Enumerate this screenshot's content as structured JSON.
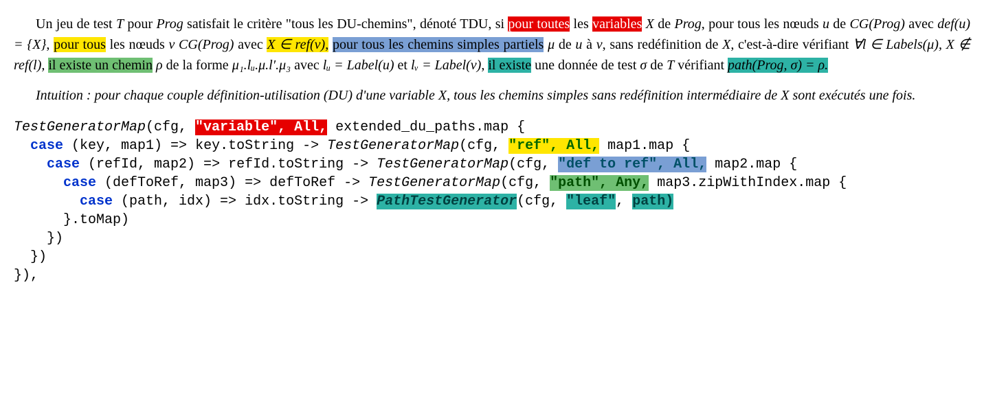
{
  "p1": {
    "t1": "Un jeu de test ",
    "T": "T",
    "t2": " pour ",
    "Prog": "Prog",
    "t3": " satisfait le critère \"tous les DU-chemins\", dénoté TDU, si ",
    "hl_pour_toutes": "pour toutes",
    "t4": " les ",
    "hl_variables": "variables",
    "t5": " ",
    "X": "X",
    "t6": " de ",
    "Prog2": "Prog",
    "t7": ", pour tous les nœuds ",
    "u": "u",
    "t8": " de ",
    "CGProg": "CG(Prog)",
    "t9": " avec ",
    "defu": "def(u) = {X}",
    "t10": ", ",
    "hl_pour_tous": "pour tous",
    "t11": " les nœuds ",
    "v": "v",
    "t12": " ",
    "CGProg2": "CG(Prog)",
    "t13": " avec ",
    "hl_Xrefv": "X ∈ ref(v),",
    "t14": " ",
    "hl_chemins": "pour tous les chemins simples partiels",
    "t15": " ",
    "mu": "μ",
    "t16": " de ",
    "u2": "u",
    "t17": " à ",
    "v2": "v",
    "t18": ", sans redéfinition de ",
    "X2": "X",
    "t19": ", c'est-à-dire vérifiant ",
    "forall": "∀l ∈ Labels(μ), X ∉ ref(l),",
    "t20": " ",
    "hl_existe_chemin": "il existe un chemin",
    "t21": " ",
    "rho": "ρ",
    "t22": " de la forme ",
    "form": "μ₁.lᵤ.μ.l′.μ₃",
    "t23": " avec ",
    "lu_eq": "lᵤ = Label(u)",
    "t24": " et ",
    "lv_eq": "lᵥ = Label(v)",
    "t25": ", ",
    "hl_il_existe": "il existe",
    "t26": " une donnée de test ",
    "sigma": "σ",
    "t27": " de ",
    "T2": "T",
    "t28": " vérifiant ",
    "hl_path_eq": "path(Prog, σ) = ρ."
  },
  "p2": {
    "text": "Intuition : pour chaque couple définition-utilisation (DU) d'une variable X, tous les chemins simples sans redéfinition intermédiaire de X sont exécutés une fois."
  },
  "code": {
    "l1a": "TestGeneratorMap",
    "l1b": "(cfg, ",
    "l1_var": "\"variable\", All,",
    "l1c": " extended_du_paths.map {",
    "l2a": "  ",
    "l2_case": "case",
    "l2b": " (key, map1) => key.toString -> ",
    "l2_tgm": "TestGeneratorMap",
    "l2c": "(cfg, ",
    "l2_ref": "\"ref\", All,",
    "l2d": " map1.map {",
    "l3a": "    ",
    "l3_case": "case",
    "l3b": " (refId, map2) => refId.toString -> ",
    "l3_tgm": "TestGeneratorMap",
    "l3c": "(cfg, ",
    "l3_def": "\"def to ref\", All,",
    "l3d": " map2.map {",
    "l4a": "      ",
    "l4_case": "case",
    "l4b": " (defToRef, map3) => defToRef -> ",
    "l4_tgm": "TestGeneratorMap",
    "l4c": "(cfg, ",
    "l4_path": "\"path\", Any,",
    "l4d": " map3.zipWithIndex.map {",
    "l5a": "        ",
    "l5_case": "case",
    "l5b": " (path, idx) => idx.toString -> ",
    "l5_ptg": "PathTestGenerator",
    "l5c": "(cfg, ",
    "l5_leaf": "\"leaf\"",
    "l5d": ", ",
    "l5_path": "path",
    "l5e": ")",
    "l6": "      }.toMap)",
    "l7": "    })",
    "l8": "  })",
    "l9": "}),"
  }
}
